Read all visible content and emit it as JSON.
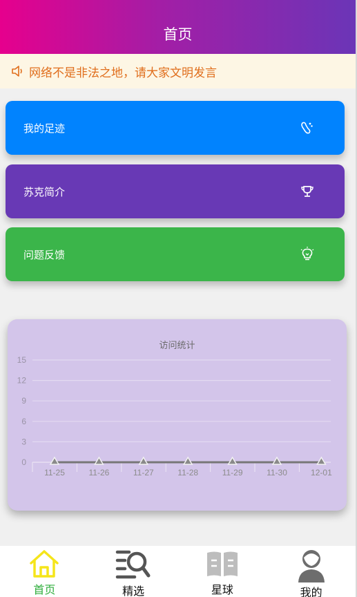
{
  "header": {
    "title": "首页"
  },
  "notice": {
    "text": "网络不是非法之地，请大家文明发言",
    "icon": "speaker-icon"
  },
  "menu": [
    {
      "label": "我的足迹",
      "icon": "footprint-icon",
      "color": "#0183fe"
    },
    {
      "label": "苏克简介",
      "icon": "trophy-icon",
      "color": "#6839b5"
    },
    {
      "label": "问题反馈",
      "icon": "lightbulb-icon",
      "color": "#3bb54a"
    }
  ],
  "chart_data": {
    "type": "line",
    "title": "访问统计",
    "categories": [
      "11-25",
      "11-26",
      "11-27",
      "11-28",
      "11-29",
      "11-30",
      "12-01"
    ],
    "series": [
      {
        "values": [
          0,
          0,
          0,
          0,
          0,
          0,
          0
        ]
      }
    ],
    "yticks": [
      "0",
      "3",
      "6",
      "9",
      "12",
      "15"
    ],
    "ylim": [
      0,
      15
    ],
    "grid": true
  },
  "tabbar": [
    {
      "label": "首页",
      "icon": "home-icon",
      "active": true
    },
    {
      "label": "精选",
      "icon": "search-list-icon",
      "active": false
    },
    {
      "label": "星球",
      "icon": "book-icon",
      "active": false
    },
    {
      "label": "我的",
      "icon": "user-icon",
      "active": false
    }
  ],
  "colors": {
    "active_tab": "#2fae3c",
    "home_icon": "#f5e51a",
    "notice_text": "#e06e1c"
  }
}
